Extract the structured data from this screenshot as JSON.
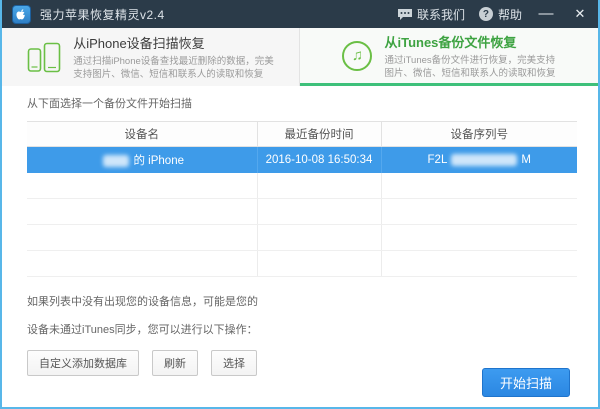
{
  "titlebar": {
    "title": "强力苹果恢复精灵v2.4",
    "contact_label": "联系我们",
    "help_label": "帮助"
  },
  "icons": {
    "minimize": "—",
    "close": "✕",
    "help": "?",
    "music": "♫"
  },
  "tabs": [
    {
      "title": "从iPhone设备扫描恢复",
      "subtitle_line1": "通过扫描iPhone设备查找最近删除的数据，完美",
      "subtitle_line2": "支持图片、微信、短信和联系人的读取和恢复",
      "active": false
    },
    {
      "title": "从iTunes备份文件恢复",
      "subtitle_line1": "通过iTunes备份文件进行恢复，完美支持",
      "subtitle_line2": "图片、微信、短信和联系人的读取和恢复",
      "active": true
    }
  ],
  "content": {
    "select_hint": "从下面选择一个备份文件开始扫描",
    "note_line1": "如果列表中没有出现您的设备信息，可能是您的",
    "note_line2": "设备未通过iTunes同步，您可以进行以下操作：",
    "buttons": {
      "add_database": "自定义添加数据库",
      "refresh": "刷新",
      "choose": "选择"
    }
  },
  "table": {
    "columns": [
      "设备名",
      "最近备份时间",
      "设备序列号"
    ],
    "selected_row": {
      "device_name_visible": "的 iPhone",
      "backup_time": "2016-10-08 16:50:34",
      "serial_prefix": "F2L",
      "serial_suffix": "M"
    },
    "empty_row_count": 4
  },
  "footer": {
    "start_scan_label": "开始扫描"
  },
  "colors": {
    "accent_blue": "#3e9be9",
    "titlebar": "#2b3b49",
    "active_green": "#3ea342",
    "underline_green": "#3ec07a",
    "window_border": "#58b7e9"
  }
}
